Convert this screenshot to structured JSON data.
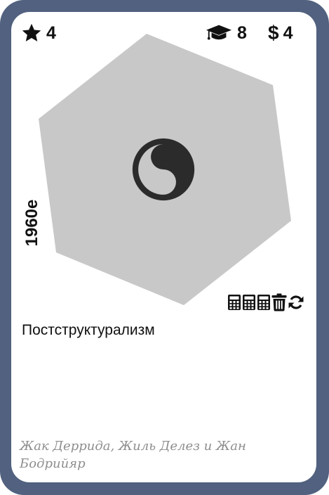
{
  "card": {
    "stars": "4",
    "education": "8",
    "cost_symbol": "$",
    "cost": "4",
    "era": "1960е",
    "name": "Постструктурализм",
    "flavor": "Жак Деррида, Жиль Делез и Жан Бодрийяр",
    "icons": {
      "stars": "star-icon",
      "education": "graduation-cap-icon",
      "emblem": "yin-yang-icon",
      "actions": [
        "calculator-icon",
        "calculator-icon",
        "calculator-icon",
        "trash-icon",
        "refresh-icon"
      ]
    },
    "colors": {
      "frame": "#51617f",
      "hexagon": "#c8c8c8",
      "text": "#111111",
      "flavor": "#8e8e8e"
    }
  }
}
